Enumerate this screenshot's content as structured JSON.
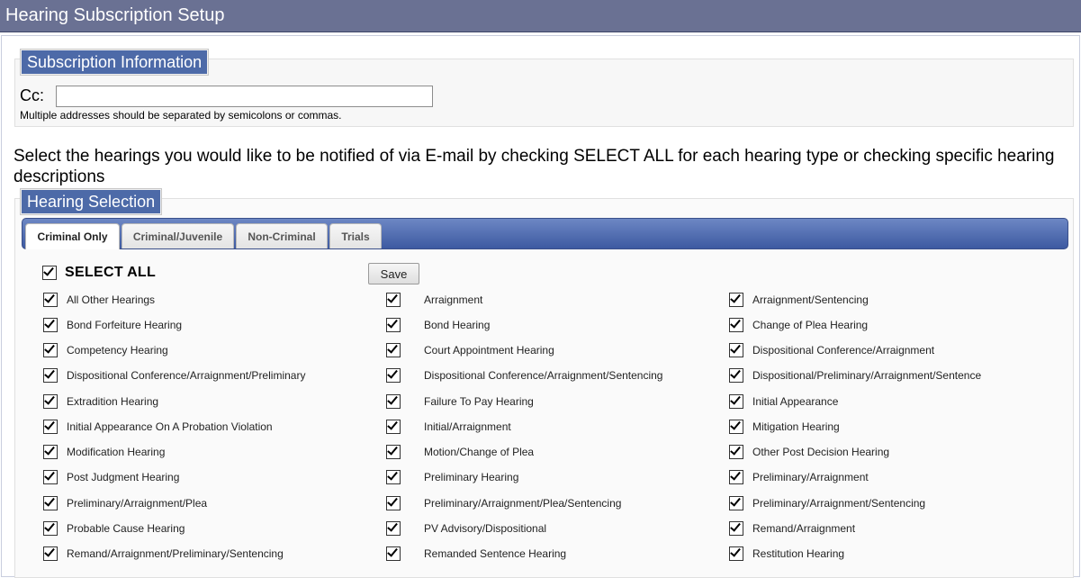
{
  "header": {
    "title": "Hearing Subscription Setup"
  },
  "subscription": {
    "legend": "Subscription Information",
    "cc_label": "Cc:",
    "cc_value": "",
    "help_text": "Multiple addresses should be separated by semicolons or commas."
  },
  "instruction": "Select the hearings you would like to be notified of via E-mail by checking SELECT ALL for each hearing type or checking specific hearing descriptions",
  "hearing_selection": {
    "legend": "Hearing Selection",
    "tabs": [
      {
        "label": "Criminal Only",
        "active": true
      },
      {
        "label": "Criminal/Juvenile",
        "active": false
      },
      {
        "label": "Non-Criminal",
        "active": false
      },
      {
        "label": "Trials",
        "active": false
      }
    ],
    "select_all_label": "SELECT ALL",
    "select_all_checked": true,
    "save_label": "Save",
    "hearings": [
      "All Other Hearings",
      "Arraignment",
      "Arraignment/Sentencing",
      "Bond Forfeiture Hearing",
      "Bond Hearing",
      "Change of Plea Hearing",
      "Competency Hearing",
      "Court Appointment Hearing",
      "Dispositional Conference/Arraignment",
      "Dispositional Conference/Arraignment/Preliminary",
      "Dispositional Conference/Arraignment/Sentencing",
      "Dispositional/Preliminary/Arraignment/Sentence",
      "Extradition Hearing",
      "Failure To Pay Hearing",
      "Initial Appearance",
      "Initial Appearance On A Probation Violation",
      "Initial/Arraignment",
      "Mitigation Hearing",
      "Modification Hearing",
      "Motion/Change of Plea",
      "Other Post Decision Hearing",
      "Post Judgment Hearing",
      "Preliminary Hearing",
      "Preliminary/Arraignment",
      "Preliminary/Arraignment/Plea",
      "Preliminary/Arraignment/Plea/Sentencing",
      "Preliminary/Arraignment/Sentencing",
      "Probable Cause Hearing",
      "PV Advisory/Dispositional",
      "Remand/Arraignment",
      "Remand/Arraignment/Preliminary/Sentencing",
      "Remanded Sentence Hearing",
      "Restitution Hearing"
    ]
  }
}
